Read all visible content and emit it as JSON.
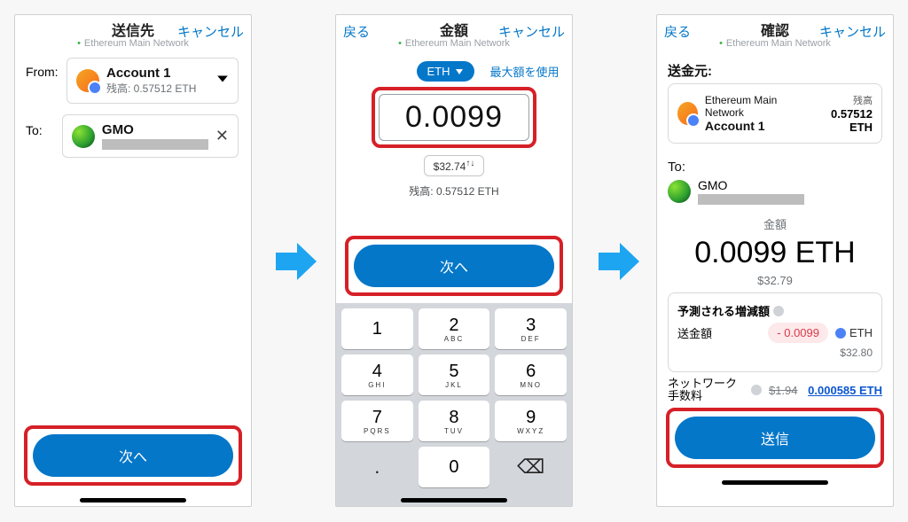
{
  "network_label": "Ethereum Main Network",
  "cancel_label": "キャンセル",
  "back_label": "戻る",
  "next_label": "次へ",
  "screen1": {
    "title": "送信先",
    "from_label": "From:",
    "to_label": "To:",
    "account_name": "Account 1",
    "account_balance": "残高: 0.57512 ETH",
    "recipient_name": "GMO"
  },
  "screen2": {
    "title": "金額",
    "asset_chip": "ETH",
    "use_max": "最大額を使用",
    "amount": "0.0099",
    "fiat": "$32.74",
    "fiat_suffix": "↑↓",
    "balance": "残高: 0.57512 ETH",
    "keypad": [
      {
        "d": "1",
        "s": ""
      },
      {
        "d": "2",
        "s": "ABC"
      },
      {
        "d": "3",
        "s": "DEF"
      },
      {
        "d": "4",
        "s": "GHI"
      },
      {
        "d": "5",
        "s": "JKL"
      },
      {
        "d": "6",
        "s": "MNO"
      },
      {
        "d": "7",
        "s": "PQRS"
      },
      {
        "d": "8",
        "s": "TUV"
      },
      {
        "d": "9",
        "s": "WXYZ"
      }
    ],
    "key_dot": ".",
    "key_zero": "0",
    "key_del": "⌫"
  },
  "screen3": {
    "title": "確認",
    "source_label": "送金元:",
    "network": "Ethereum Main Network",
    "account": "Account 1",
    "balance_label": "残高",
    "balance_value": "0.57512 ETH",
    "to_label": "To:",
    "recipient": "GMO",
    "amount_heading": "金額",
    "amount": "0.0099 ETH",
    "fiat": "$32.79",
    "predicted_heading": "予測される増減額",
    "send_amount_label": "送金額",
    "send_amount_neg": "- 0.0099",
    "send_amount_unit": "ETH",
    "send_amount_fiat": "$32.80",
    "netfee_label": "ネットワーク手数料",
    "netfee_strike": "$1.94",
    "netfee_eth": "0.000585 ETH",
    "send_btn": "送信"
  }
}
